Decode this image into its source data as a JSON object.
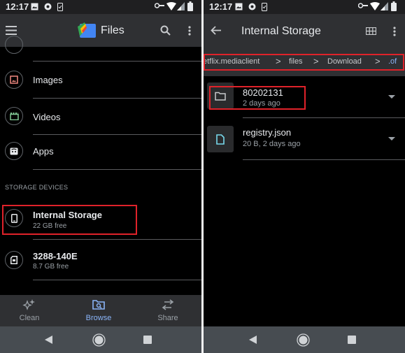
{
  "status_bar": {
    "time": "12:17"
  },
  "left_pane": {
    "app_title": "Files",
    "categories": [
      {
        "label": "Images",
        "icon": "image-icon",
        "color": "#f28b82"
      },
      {
        "label": "Videos",
        "icon": "video-icon",
        "color": "#81c995"
      },
      {
        "label": "Apps",
        "icon": "android-icon",
        "color": "#e8eaed"
      }
    ],
    "section_header": "STORAGE DEVICES",
    "storage_devices": [
      {
        "name": "Internal Storage",
        "free": "22 GB free",
        "icon": "phone-icon",
        "highlighted": true
      },
      {
        "name": "3288-140E",
        "free": "8.7 GB free",
        "icon": "sd-card-icon",
        "highlighted": false
      }
    ],
    "bottom_nav": [
      {
        "label": "Clean",
        "icon": "sparkle-icon",
        "active": false
      },
      {
        "label": "Browse",
        "icon": "browse-folder-icon",
        "active": true
      },
      {
        "label": "Share",
        "icon": "swap-arrows-icon",
        "active": false
      }
    ]
  },
  "right_pane": {
    "title": "Internal Storage",
    "breadcrumb": [
      "etflix.mediaclient",
      "files",
      "Download",
      ".of"
    ],
    "files": [
      {
        "name": "80202131",
        "meta": "2 days ago",
        "type": "folder",
        "highlighted": true
      },
      {
        "name": "registry.json",
        "meta": "20 B, 2 days ago",
        "type": "file",
        "highlighted": false
      }
    ]
  },
  "colors": {
    "accent": "#8ab4f8",
    "highlight_box": "#e0222a",
    "appbar": "#2f3033",
    "system_nav": "#474c51"
  }
}
